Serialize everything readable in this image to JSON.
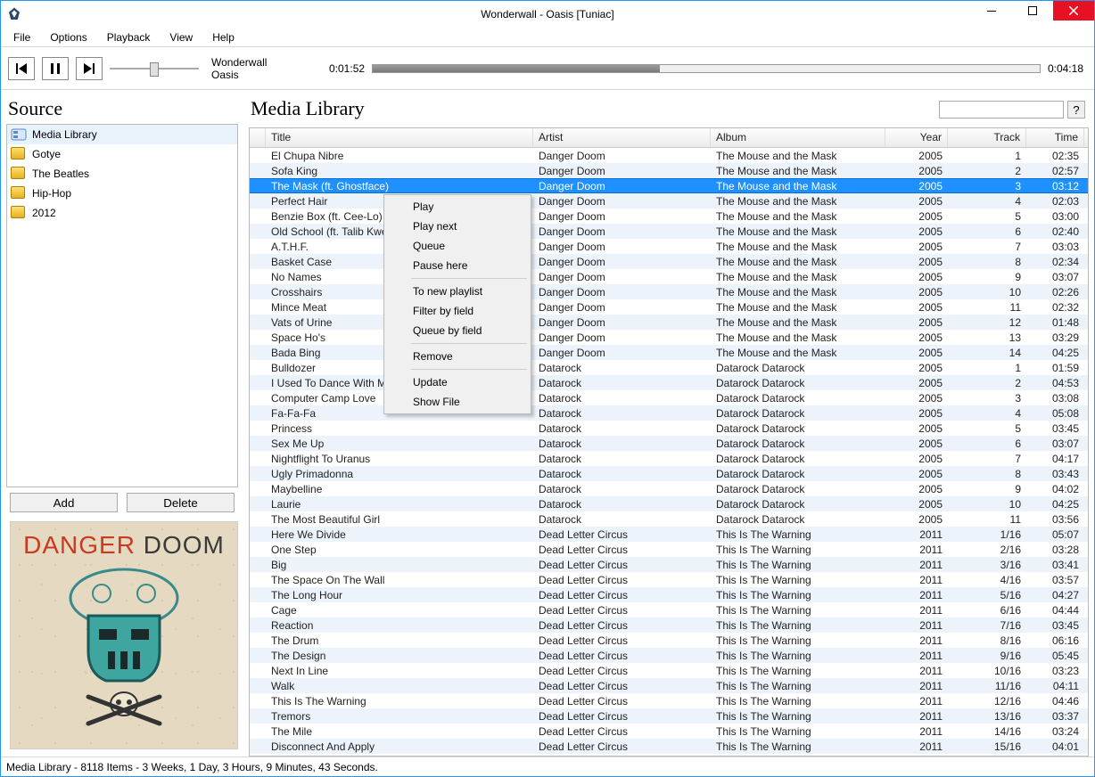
{
  "window": {
    "title": "Wonderwall - Oasis [Tuniac]"
  },
  "menu": {
    "file": "File",
    "options": "Options",
    "playback": "Playback",
    "view": "View",
    "help": "Help"
  },
  "player": {
    "now_playing_title": "Wonderwall",
    "now_playing_artist": "Oasis",
    "elapsed": "0:01:52",
    "total": "0:04:18"
  },
  "source": {
    "header": "Source",
    "items": [
      {
        "label": "Media Library",
        "selected": true,
        "icon": "library"
      },
      {
        "label": "Gotye",
        "icon": "playlist"
      },
      {
        "label": "The Beatles",
        "icon": "playlist"
      },
      {
        "label": "Hip-Hop",
        "icon": "playlist"
      },
      {
        "label": "2012",
        "icon": "playlist"
      }
    ],
    "add_btn": "Add",
    "delete_btn": "Delete"
  },
  "library": {
    "header": "Media Library",
    "search_help": "?",
    "columns": {
      "title": "Title",
      "artist": "Artist",
      "album": "Album",
      "year": "Year",
      "track": "Track",
      "time": "Time"
    },
    "rows": [
      {
        "title": "El Chupa Nibre",
        "artist": "Danger Doom",
        "album": "The Mouse and the Mask",
        "year": "2005",
        "track": "1",
        "time": "02:35"
      },
      {
        "title": "Sofa King",
        "artist": "Danger Doom",
        "album": "The Mouse and the Mask",
        "year": "2005",
        "track": "2",
        "time": "02:57"
      },
      {
        "title": "The Mask (ft. Ghostface)",
        "artist": "Danger Doom",
        "album": "The Mouse and the Mask",
        "year": "2005",
        "track": "3",
        "time": "03:12",
        "selected": true
      },
      {
        "title": "Perfect Hair",
        "artist": "Danger Doom",
        "album": "The Mouse and the Mask",
        "year": "2005",
        "track": "4",
        "time": "02:03"
      },
      {
        "title": "Benzie Box (ft. Cee-Lo)",
        "artist": "Danger Doom",
        "album": "The Mouse and the Mask",
        "year": "2005",
        "track": "5",
        "time": "03:00"
      },
      {
        "title": "Old School (ft. Talib Kweli)",
        "artist": "Danger Doom",
        "album": "The Mouse and the Mask",
        "year": "2005",
        "track": "6",
        "time": "02:40"
      },
      {
        "title": "A.T.H.F.",
        "artist": "Danger Doom",
        "album": "The Mouse and the Mask",
        "year": "2005",
        "track": "7",
        "time": "03:03"
      },
      {
        "title": "Basket Case",
        "artist": "Danger Doom",
        "album": "The Mouse and the Mask",
        "year": "2005",
        "track": "8",
        "time": "02:34"
      },
      {
        "title": "No Names",
        "artist": "Danger Doom",
        "album": "The Mouse and the Mask",
        "year": "2005",
        "track": "9",
        "time": "03:07"
      },
      {
        "title": "Crosshairs",
        "artist": "Danger Doom",
        "album": "The Mouse and the Mask",
        "year": "2005",
        "track": "10",
        "time": "02:26"
      },
      {
        "title": "Mince Meat",
        "artist": "Danger Doom",
        "album": "The Mouse and the Mask",
        "year": "2005",
        "track": "11",
        "time": "02:32"
      },
      {
        "title": "Vats of Urine",
        "artist": "Danger Doom",
        "album": "The Mouse and the Mask",
        "year": "2005",
        "track": "12",
        "time": "01:48"
      },
      {
        "title": "Space Ho's",
        "artist": "Danger Doom",
        "album": "The Mouse and the Mask",
        "year": "2005",
        "track": "13",
        "time": "03:29"
      },
      {
        "title": "Bada Bing",
        "artist": "Danger Doom",
        "album": "The Mouse and the Mask",
        "year": "2005",
        "track": "14",
        "time": "04:25"
      },
      {
        "title": "Bulldozer",
        "artist": "Datarock",
        "album": "Datarock Datarock",
        "year": "2005",
        "track": "1",
        "time": "01:59"
      },
      {
        "title": "I Used To Dance With My Daddy",
        "artist": "Datarock",
        "album": "Datarock Datarock",
        "year": "2005",
        "track": "2",
        "time": "04:53"
      },
      {
        "title": "Computer Camp Love",
        "artist": "Datarock",
        "album": "Datarock Datarock",
        "year": "2005",
        "track": "3",
        "time": "03:08"
      },
      {
        "title": "Fa-Fa-Fa",
        "artist": "Datarock",
        "album": "Datarock Datarock",
        "year": "2005",
        "track": "4",
        "time": "05:08"
      },
      {
        "title": "Princess",
        "artist": "Datarock",
        "album": "Datarock Datarock",
        "year": "2005",
        "track": "5",
        "time": "03:45"
      },
      {
        "title": "Sex Me Up",
        "artist": "Datarock",
        "album": "Datarock Datarock",
        "year": "2005",
        "track": "6",
        "time": "03:07"
      },
      {
        "title": "Nightflight To Uranus",
        "artist": "Datarock",
        "album": "Datarock Datarock",
        "year": "2005",
        "track": "7",
        "time": "04:17"
      },
      {
        "title": "Ugly Primadonna",
        "artist": "Datarock",
        "album": "Datarock Datarock",
        "year": "2005",
        "track": "8",
        "time": "03:43"
      },
      {
        "title": "Maybelline",
        "artist": "Datarock",
        "album": "Datarock Datarock",
        "year": "2005",
        "track": "9",
        "time": "04:02"
      },
      {
        "title": "Laurie",
        "artist": "Datarock",
        "album": "Datarock Datarock",
        "year": "2005",
        "track": "10",
        "time": "04:25"
      },
      {
        "title": "The Most Beautiful Girl",
        "artist": "Datarock",
        "album": "Datarock Datarock",
        "year": "2005",
        "track": "11",
        "time": "03:56"
      },
      {
        "title": "Here We Divide",
        "artist": "Dead Letter Circus",
        "album": "This Is The Warning",
        "year": "2011",
        "track": "1/16",
        "time": "05:07"
      },
      {
        "title": "One Step",
        "artist": "Dead Letter Circus",
        "album": "This Is The Warning",
        "year": "2011",
        "track": "2/16",
        "time": "03:28"
      },
      {
        "title": "Big",
        "artist": "Dead Letter Circus",
        "album": "This Is The Warning",
        "year": "2011",
        "track": "3/16",
        "time": "03:41"
      },
      {
        "title": "The Space On The Wall",
        "artist": "Dead Letter Circus",
        "album": "This Is The Warning",
        "year": "2011",
        "track": "4/16",
        "time": "03:57"
      },
      {
        "title": "The Long Hour",
        "artist": "Dead Letter Circus",
        "album": "This Is The Warning",
        "year": "2011",
        "track": "5/16",
        "time": "04:27"
      },
      {
        "title": "Cage",
        "artist": "Dead Letter Circus",
        "album": "This Is The Warning",
        "year": "2011",
        "track": "6/16",
        "time": "04:44"
      },
      {
        "title": "Reaction",
        "artist": "Dead Letter Circus",
        "album": "This Is The Warning",
        "year": "2011",
        "track": "7/16",
        "time": "03:45"
      },
      {
        "title": "The Drum",
        "artist": "Dead Letter Circus",
        "album": "This Is The Warning",
        "year": "2011",
        "track": "8/16",
        "time": "06:16"
      },
      {
        "title": "The Design",
        "artist": "Dead Letter Circus",
        "album": "This Is The Warning",
        "year": "2011",
        "track": "9/16",
        "time": "05:45"
      },
      {
        "title": "Next In Line",
        "artist": "Dead Letter Circus",
        "album": "This Is The Warning",
        "year": "2011",
        "track": "10/16",
        "time": "03:23"
      },
      {
        "title": "Walk",
        "artist": "Dead Letter Circus",
        "album": "This Is The Warning",
        "year": "2011",
        "track": "11/16",
        "time": "04:11"
      },
      {
        "title": "This Is The Warning",
        "artist": "Dead Letter Circus",
        "album": "This Is The Warning",
        "year": "2011",
        "track": "12/16",
        "time": "04:46"
      },
      {
        "title": "Tremors",
        "artist": "Dead Letter Circus",
        "album": "This Is The Warning",
        "year": "2011",
        "track": "13/16",
        "time": "03:37"
      },
      {
        "title": "The Mile",
        "artist": "Dead Letter Circus",
        "album": "This Is The Warning",
        "year": "2011",
        "track": "14/16",
        "time": "03:24"
      },
      {
        "title": "Disconnect And Apply",
        "artist": "Dead Letter Circus",
        "album": "This Is The Warning",
        "year": "2011",
        "track": "15/16",
        "time": "04:01"
      }
    ]
  },
  "context_menu": {
    "items": [
      {
        "label": "Play"
      },
      {
        "label": "Play next"
      },
      {
        "label": "Queue"
      },
      {
        "label": "Pause here"
      },
      {
        "sep": true
      },
      {
        "label": "To new playlist"
      },
      {
        "label": "Filter by field"
      },
      {
        "label": "Queue by field"
      },
      {
        "sep": true
      },
      {
        "label": "Remove"
      },
      {
        "sep": true
      },
      {
        "label": "Update"
      },
      {
        "label": "Show File"
      }
    ]
  },
  "statusbar": {
    "text": "Media Library - 8118 Items - 3 Weeks, 1 Day, 3 Hours, 9 Minutes, 43 Seconds."
  },
  "album_art": {
    "line1_a": "DANGER",
    "line1_b": " DOOM"
  }
}
